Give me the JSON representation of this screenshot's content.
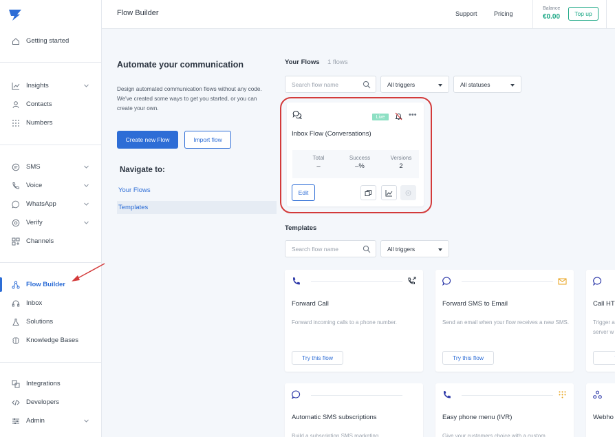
{
  "app": {
    "logo": "messagebird-logo"
  },
  "header": {
    "title": "Flow Builder",
    "support": "Support",
    "pricing": "Pricing",
    "balance_label": "Balance",
    "balance_value": "€0.00",
    "topup": "Top up"
  },
  "sidebar": {
    "items": [
      {
        "label": "Getting started",
        "icon": "home-icon"
      },
      {
        "label": "Insights",
        "icon": "chart-icon",
        "expandable": true
      },
      {
        "label": "Contacts",
        "icon": "person-icon"
      },
      {
        "label": "Numbers",
        "icon": "grid-dots-icon"
      },
      {
        "label": "SMS",
        "icon": "sms-icon",
        "expandable": true
      },
      {
        "label": "Voice",
        "icon": "phone-icon",
        "expandable": true
      },
      {
        "label": "WhatsApp",
        "icon": "whatsapp-icon",
        "expandable": true
      },
      {
        "label": "Verify",
        "icon": "verify-icon",
        "expandable": true
      },
      {
        "label": "Channels",
        "icon": "channels-icon"
      },
      {
        "label": "Flow Builder",
        "icon": "flow-icon",
        "active": true
      },
      {
        "label": "Inbox",
        "icon": "headset-icon"
      },
      {
        "label": "Solutions",
        "icon": "flask-icon"
      },
      {
        "label": "Knowledge Bases",
        "icon": "brain-icon"
      },
      {
        "label": "Integrations",
        "icon": "integrations-icon"
      },
      {
        "label": "Developers",
        "icon": "code-icon"
      },
      {
        "label": "Admin",
        "icon": "sliders-icon",
        "expandable": true
      }
    ]
  },
  "intro": {
    "title": "Automate your communication",
    "text": "Design automated communication flows without any code. We've created some ways to get you started, or you can create your own.",
    "create_button": "Create new Flow",
    "import_button": "Import flow",
    "navigate_title": "Navigate to:",
    "nav_links": [
      "Your Flows",
      "Templates"
    ]
  },
  "flows": {
    "title": "Your Flows",
    "count": "1 flows",
    "search_placeholder": "Search flow name",
    "trigger_filter": "All triggers",
    "status_filter": "All statuses",
    "items": [
      {
        "name": "Inbox Flow (Conversations)",
        "badge": "Live",
        "stats": [
          {
            "label": "Total",
            "value": "–"
          },
          {
            "label": "Success",
            "value": "–%"
          },
          {
            "label": "Versions",
            "value": "2"
          }
        ],
        "edit": "Edit"
      }
    ]
  },
  "templates": {
    "title": "Templates",
    "search_placeholder": "Search flow name",
    "trigger_filter": "All triggers",
    "items": [
      {
        "title": "Forward Call",
        "desc": "Forward incoming calls to a phone number.",
        "button": "Try this flow"
      },
      {
        "title": "Forward SMS to Email",
        "desc": "Send an email when your flow receives a new SMS.",
        "button": "Try this flow"
      },
      {
        "title": "Call HT",
        "desc": "Trigger a server w",
        "button": "Try"
      },
      {
        "title": "Automatic SMS subscriptions",
        "desc": "Build a subscription SMS marketing"
      },
      {
        "title": "Easy phone menu (IVR)",
        "desc": "Give your customers choice with a custom"
      },
      {
        "title": "Webho",
        "desc": ""
      }
    ]
  },
  "colors": {
    "accent": "#2d6dd6",
    "balance": "#1aa784",
    "highlight": "#d33a3a",
    "live_badge": "#8ee0c4"
  }
}
